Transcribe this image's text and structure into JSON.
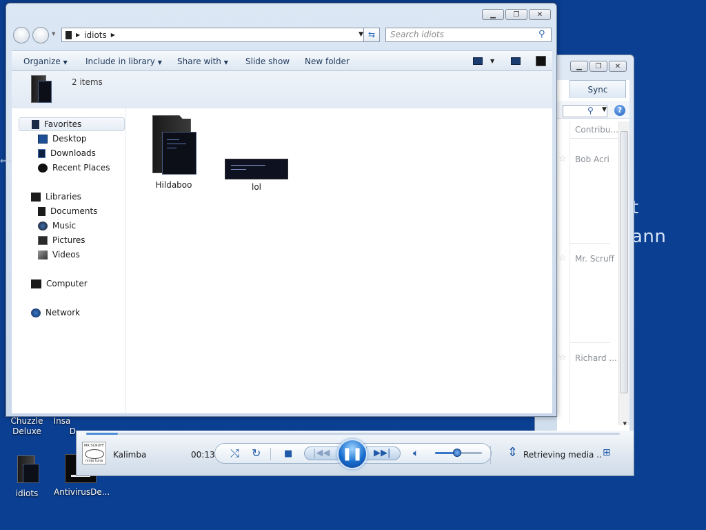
{
  "background": {
    "text_line1": "t",
    "text_line2": "ann"
  },
  "desktop_icons": [
    {
      "label_line1": "Chuzzle",
      "label_line2": "Deluxe"
    },
    {
      "label_line1": "Insa",
      "label_line2": "D"
    },
    {
      "label": "idiots"
    },
    {
      "label": "AntivirusDe..."
    }
  ],
  "media_player": {
    "sync_tab_label": "Sync",
    "column_header": "Contribu...",
    "rows": [
      {
        "artist": "Bob Acri"
      },
      {
        "artist": "Mr. Scruff"
      },
      {
        "artist": "Richard ..."
      }
    ],
    "help_glyph": "?",
    "album_art_text": "MR SCRUFF",
    "album_art_subtext": "ninja tuna",
    "track_title": "Kalimba",
    "elapsed_time": "00:13",
    "status": "Retrieving media ..",
    "progress_fraction": 0.06,
    "volume_fraction": 0.47
  },
  "explorer": {
    "breadcrumb_folder": "idiots",
    "search_placeholder": "Search idiots",
    "toolbar": {
      "organize": "Organize",
      "include_in_library": "Include in library",
      "share_with": "Share with",
      "slide_show": "Slide show",
      "new_folder": "New folder"
    },
    "item_count": "2 items",
    "nav": {
      "favorites": "Favorites",
      "desktop": "Desktop",
      "downloads": "Downloads",
      "recent_places": "Recent Places",
      "libraries": "Libraries",
      "documents": "Documents",
      "music": "Music",
      "pictures": "Pictures",
      "videos": "Videos",
      "computer": "Computer",
      "network": "Network"
    },
    "files": [
      {
        "name": "Hildaboo",
        "type": "folder"
      },
      {
        "name": "lol",
        "type": "image"
      }
    ]
  },
  "colors": {
    "desktop_background": "#0b3f92",
    "accent_blue": "#1f5aa8"
  }
}
